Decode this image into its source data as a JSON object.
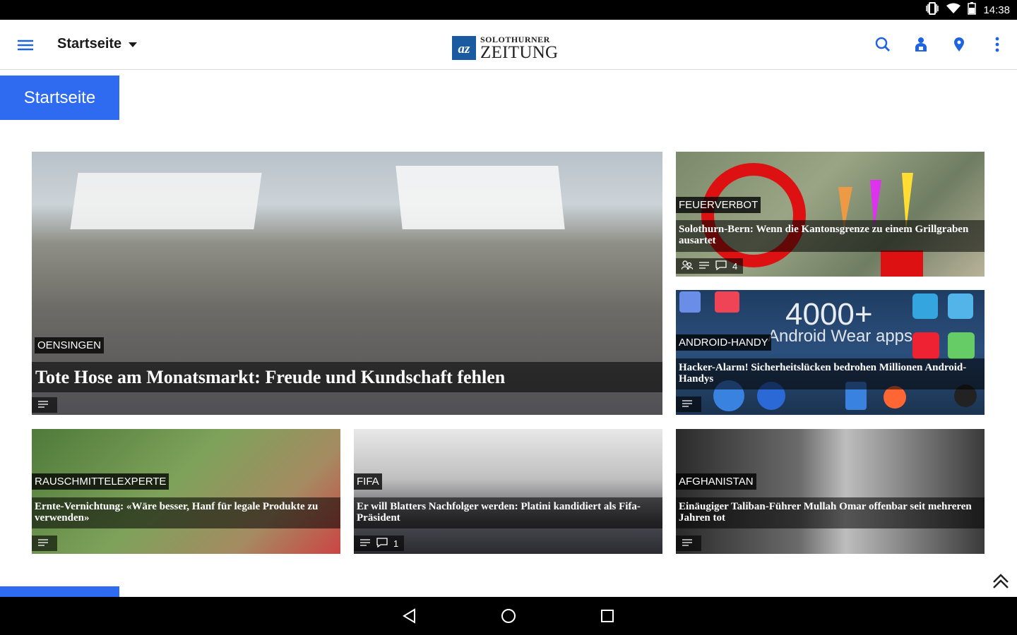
{
  "status_bar": {
    "time": "14:38",
    "icons": [
      "vibrate-icon",
      "wifi-icon",
      "battery-icon"
    ]
  },
  "app_bar": {
    "section_label": "Startseite",
    "logo": {
      "mark": "az",
      "line1": "SOLOTHURNER",
      "line2": "ZEITUNG"
    },
    "actions": [
      "search-icon",
      "account-icon",
      "location-icon",
      "more-vert-icon"
    ]
  },
  "tabs": {
    "active_label": "Startseite"
  },
  "colors": {
    "accent": "#2e6bf0",
    "icon_blue": "#1e63e0"
  },
  "articles": [
    {
      "kicker": "OENSINGEN",
      "headline": "Tote Hose am Monatsmarkt: Freude und Kundschaft fehlen",
      "comments": ""
    },
    {
      "kicker": "FEUERVERBOT",
      "headline": "Solothurn-Bern: Wenn die Kantonsgrenze zu einem Grillgraben ausartet",
      "comments": "4"
    },
    {
      "kicker": "ANDROID-HANDY",
      "headline": "Hacker-Alarm! Sicherheitslücken bedrohen Millionen Android-Handys",
      "comments": "",
      "image_text": {
        "big": "4000+",
        "sub": "Android Wear apps"
      }
    },
    {
      "kicker": "RAUSCHMITTELEXPERTE",
      "headline": "Ernte-Vernichtung: «Wäre besser, Hanf für legale Produkte zu verwenden»",
      "comments": ""
    },
    {
      "kicker": "FIFA",
      "headline": "Er will Blatters Nachfolger werden: Platini kandidiert als Fifa-Präsident",
      "comments": "1"
    },
    {
      "kicker": "AFGHANISTAN",
      "headline": "Einäugiger Taliban-Führer Mullah Omar offenbar seit mehreren Jahren tot",
      "comments": ""
    }
  ],
  "nav_bar": [
    "back-icon",
    "home-icon",
    "recents-icon"
  ]
}
